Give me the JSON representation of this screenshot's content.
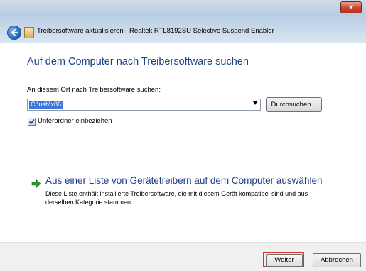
{
  "window": {
    "title": "Treibersoftware aktualisieren - Realtek RTL8192SU Selective Suspend Enabler",
    "close_label": "x"
  },
  "main": {
    "heading": "Auf dem Computer nach Treibersoftware suchen",
    "path_label": "An diesem Ort nach Treibersoftware suchen:",
    "path_value": "C:\\usb\\x86",
    "browse_label": "Durchsuchen...",
    "include_subfolders_label": "Unterordner einbeziehen",
    "include_subfolders_checked": true,
    "pick_option_title": "Aus einer Liste von Gerätetreibern auf dem Computer auswählen",
    "pick_option_desc": "Diese Liste enthält installierte Treibersoftware, die mit diesem Gerät kompatibel sind und aus derselben Kategorie stammen."
  },
  "footer": {
    "next_label": "Weiter",
    "cancel_label": "Abbrechen"
  },
  "colors": {
    "heading_blue": "#1e3f87",
    "selection_blue": "#3c78d8",
    "highlight_red": "#d8322b",
    "arrow_green": "#2e9a2e"
  },
  "icons": {
    "back": "back-arrow-icon",
    "wizard": "driver-wizard-icon",
    "option": "green-arrow-icon",
    "close": "close-icon"
  }
}
